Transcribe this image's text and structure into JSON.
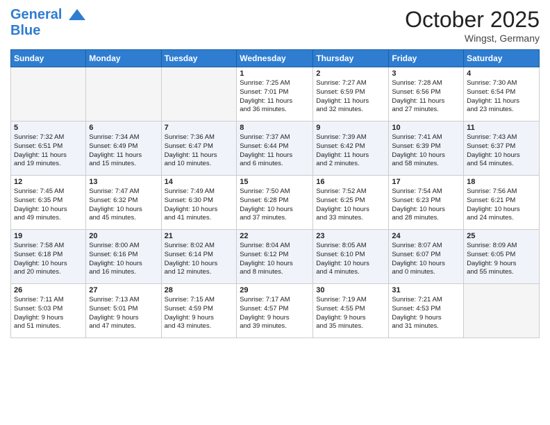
{
  "header": {
    "logo_line1": "General",
    "logo_line2": "Blue",
    "month": "October 2025",
    "location": "Wingst, Germany"
  },
  "columns": [
    "Sunday",
    "Monday",
    "Tuesday",
    "Wednesday",
    "Thursday",
    "Friday",
    "Saturday"
  ],
  "weeks": [
    [
      {
        "day": "",
        "info": ""
      },
      {
        "day": "",
        "info": ""
      },
      {
        "day": "",
        "info": ""
      },
      {
        "day": "1",
        "info": "Sunrise: 7:25 AM\nSunset: 7:01 PM\nDaylight: 11 hours\nand 36 minutes."
      },
      {
        "day": "2",
        "info": "Sunrise: 7:27 AM\nSunset: 6:59 PM\nDaylight: 11 hours\nand 32 minutes."
      },
      {
        "day": "3",
        "info": "Sunrise: 7:28 AM\nSunset: 6:56 PM\nDaylight: 11 hours\nand 27 minutes."
      },
      {
        "day": "4",
        "info": "Sunrise: 7:30 AM\nSunset: 6:54 PM\nDaylight: 11 hours\nand 23 minutes."
      }
    ],
    [
      {
        "day": "5",
        "info": "Sunrise: 7:32 AM\nSunset: 6:51 PM\nDaylight: 11 hours\nand 19 minutes."
      },
      {
        "day": "6",
        "info": "Sunrise: 7:34 AM\nSunset: 6:49 PM\nDaylight: 11 hours\nand 15 minutes."
      },
      {
        "day": "7",
        "info": "Sunrise: 7:36 AM\nSunset: 6:47 PM\nDaylight: 11 hours\nand 10 minutes."
      },
      {
        "day": "8",
        "info": "Sunrise: 7:37 AM\nSunset: 6:44 PM\nDaylight: 11 hours\nand 6 minutes."
      },
      {
        "day": "9",
        "info": "Sunrise: 7:39 AM\nSunset: 6:42 PM\nDaylight: 11 hours\nand 2 minutes."
      },
      {
        "day": "10",
        "info": "Sunrise: 7:41 AM\nSunset: 6:39 PM\nDaylight: 10 hours\nand 58 minutes."
      },
      {
        "day": "11",
        "info": "Sunrise: 7:43 AM\nSunset: 6:37 PM\nDaylight: 10 hours\nand 54 minutes."
      }
    ],
    [
      {
        "day": "12",
        "info": "Sunrise: 7:45 AM\nSunset: 6:35 PM\nDaylight: 10 hours\nand 49 minutes."
      },
      {
        "day": "13",
        "info": "Sunrise: 7:47 AM\nSunset: 6:32 PM\nDaylight: 10 hours\nand 45 minutes."
      },
      {
        "day": "14",
        "info": "Sunrise: 7:49 AM\nSunset: 6:30 PM\nDaylight: 10 hours\nand 41 minutes."
      },
      {
        "day": "15",
        "info": "Sunrise: 7:50 AM\nSunset: 6:28 PM\nDaylight: 10 hours\nand 37 minutes."
      },
      {
        "day": "16",
        "info": "Sunrise: 7:52 AM\nSunset: 6:25 PM\nDaylight: 10 hours\nand 33 minutes."
      },
      {
        "day": "17",
        "info": "Sunrise: 7:54 AM\nSunset: 6:23 PM\nDaylight: 10 hours\nand 28 minutes."
      },
      {
        "day": "18",
        "info": "Sunrise: 7:56 AM\nSunset: 6:21 PM\nDaylight: 10 hours\nand 24 minutes."
      }
    ],
    [
      {
        "day": "19",
        "info": "Sunrise: 7:58 AM\nSunset: 6:18 PM\nDaylight: 10 hours\nand 20 minutes."
      },
      {
        "day": "20",
        "info": "Sunrise: 8:00 AM\nSunset: 6:16 PM\nDaylight: 10 hours\nand 16 minutes."
      },
      {
        "day": "21",
        "info": "Sunrise: 8:02 AM\nSunset: 6:14 PM\nDaylight: 10 hours\nand 12 minutes."
      },
      {
        "day": "22",
        "info": "Sunrise: 8:04 AM\nSunset: 6:12 PM\nDaylight: 10 hours\nand 8 minutes."
      },
      {
        "day": "23",
        "info": "Sunrise: 8:05 AM\nSunset: 6:10 PM\nDaylight: 10 hours\nand 4 minutes."
      },
      {
        "day": "24",
        "info": "Sunrise: 8:07 AM\nSunset: 6:07 PM\nDaylight: 10 hours\nand 0 minutes."
      },
      {
        "day": "25",
        "info": "Sunrise: 8:09 AM\nSunset: 6:05 PM\nDaylight: 9 hours\nand 55 minutes."
      }
    ],
    [
      {
        "day": "26",
        "info": "Sunrise: 7:11 AM\nSunset: 5:03 PM\nDaylight: 9 hours\nand 51 minutes."
      },
      {
        "day": "27",
        "info": "Sunrise: 7:13 AM\nSunset: 5:01 PM\nDaylight: 9 hours\nand 47 minutes."
      },
      {
        "day": "28",
        "info": "Sunrise: 7:15 AM\nSunset: 4:59 PM\nDaylight: 9 hours\nand 43 minutes."
      },
      {
        "day": "29",
        "info": "Sunrise: 7:17 AM\nSunset: 4:57 PM\nDaylight: 9 hours\nand 39 minutes."
      },
      {
        "day": "30",
        "info": "Sunrise: 7:19 AM\nSunset: 4:55 PM\nDaylight: 9 hours\nand 35 minutes."
      },
      {
        "day": "31",
        "info": "Sunrise: 7:21 AM\nSunset: 4:53 PM\nDaylight: 9 hours\nand 31 minutes."
      },
      {
        "day": "",
        "info": ""
      }
    ]
  ]
}
